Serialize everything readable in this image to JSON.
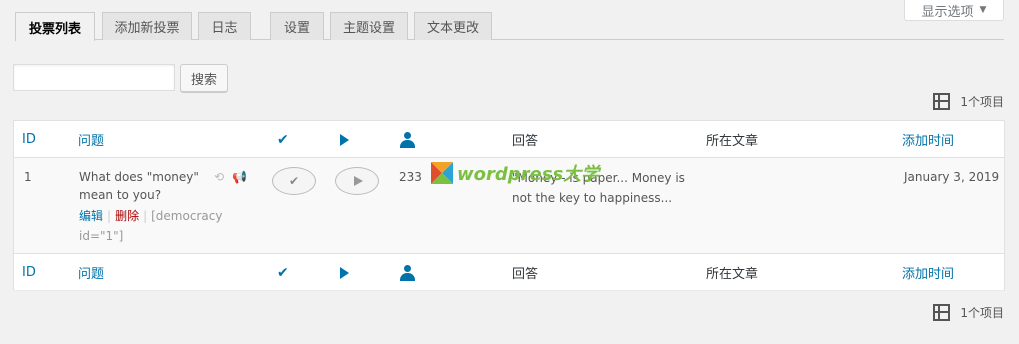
{
  "screen_options": {
    "label": "显示选项",
    "arrow": "▼"
  },
  "tabs": [
    {
      "label": "投票列表",
      "active": true
    },
    {
      "label": "添加新投票",
      "active": false
    },
    {
      "label": "日志",
      "active": false
    },
    {
      "label": "设置",
      "active": false
    },
    {
      "label": "主题设置",
      "active": false
    },
    {
      "label": "文本更改",
      "active": false
    }
  ],
  "search": {
    "value": "",
    "placeholder": "",
    "button_label": "搜索"
  },
  "pagination": {
    "count_text": "1个项目"
  },
  "table": {
    "columns": {
      "id": "ID",
      "question": "问题",
      "check": "✔",
      "answers": "回答",
      "post": "所在文章",
      "date": "添加时间"
    },
    "rows": [
      {
        "id": "1",
        "question": "What does \"money\" mean to you?",
        "actions": {
          "edit": "编辑",
          "delete": "删除",
          "separator": "|",
          "shortcode": "[democracy id=\"1\"]"
        },
        "votes": "233",
        "answers": "\"Money - is paper... Money is not the key to happiness...",
        "post": "",
        "date": "January 3, 2019"
      }
    ]
  },
  "watermark": {
    "text": "wordpress大学"
  },
  "colors": {
    "accent": "#0073aa",
    "delete": "#aa0000",
    "background": "#f1f1f1"
  }
}
